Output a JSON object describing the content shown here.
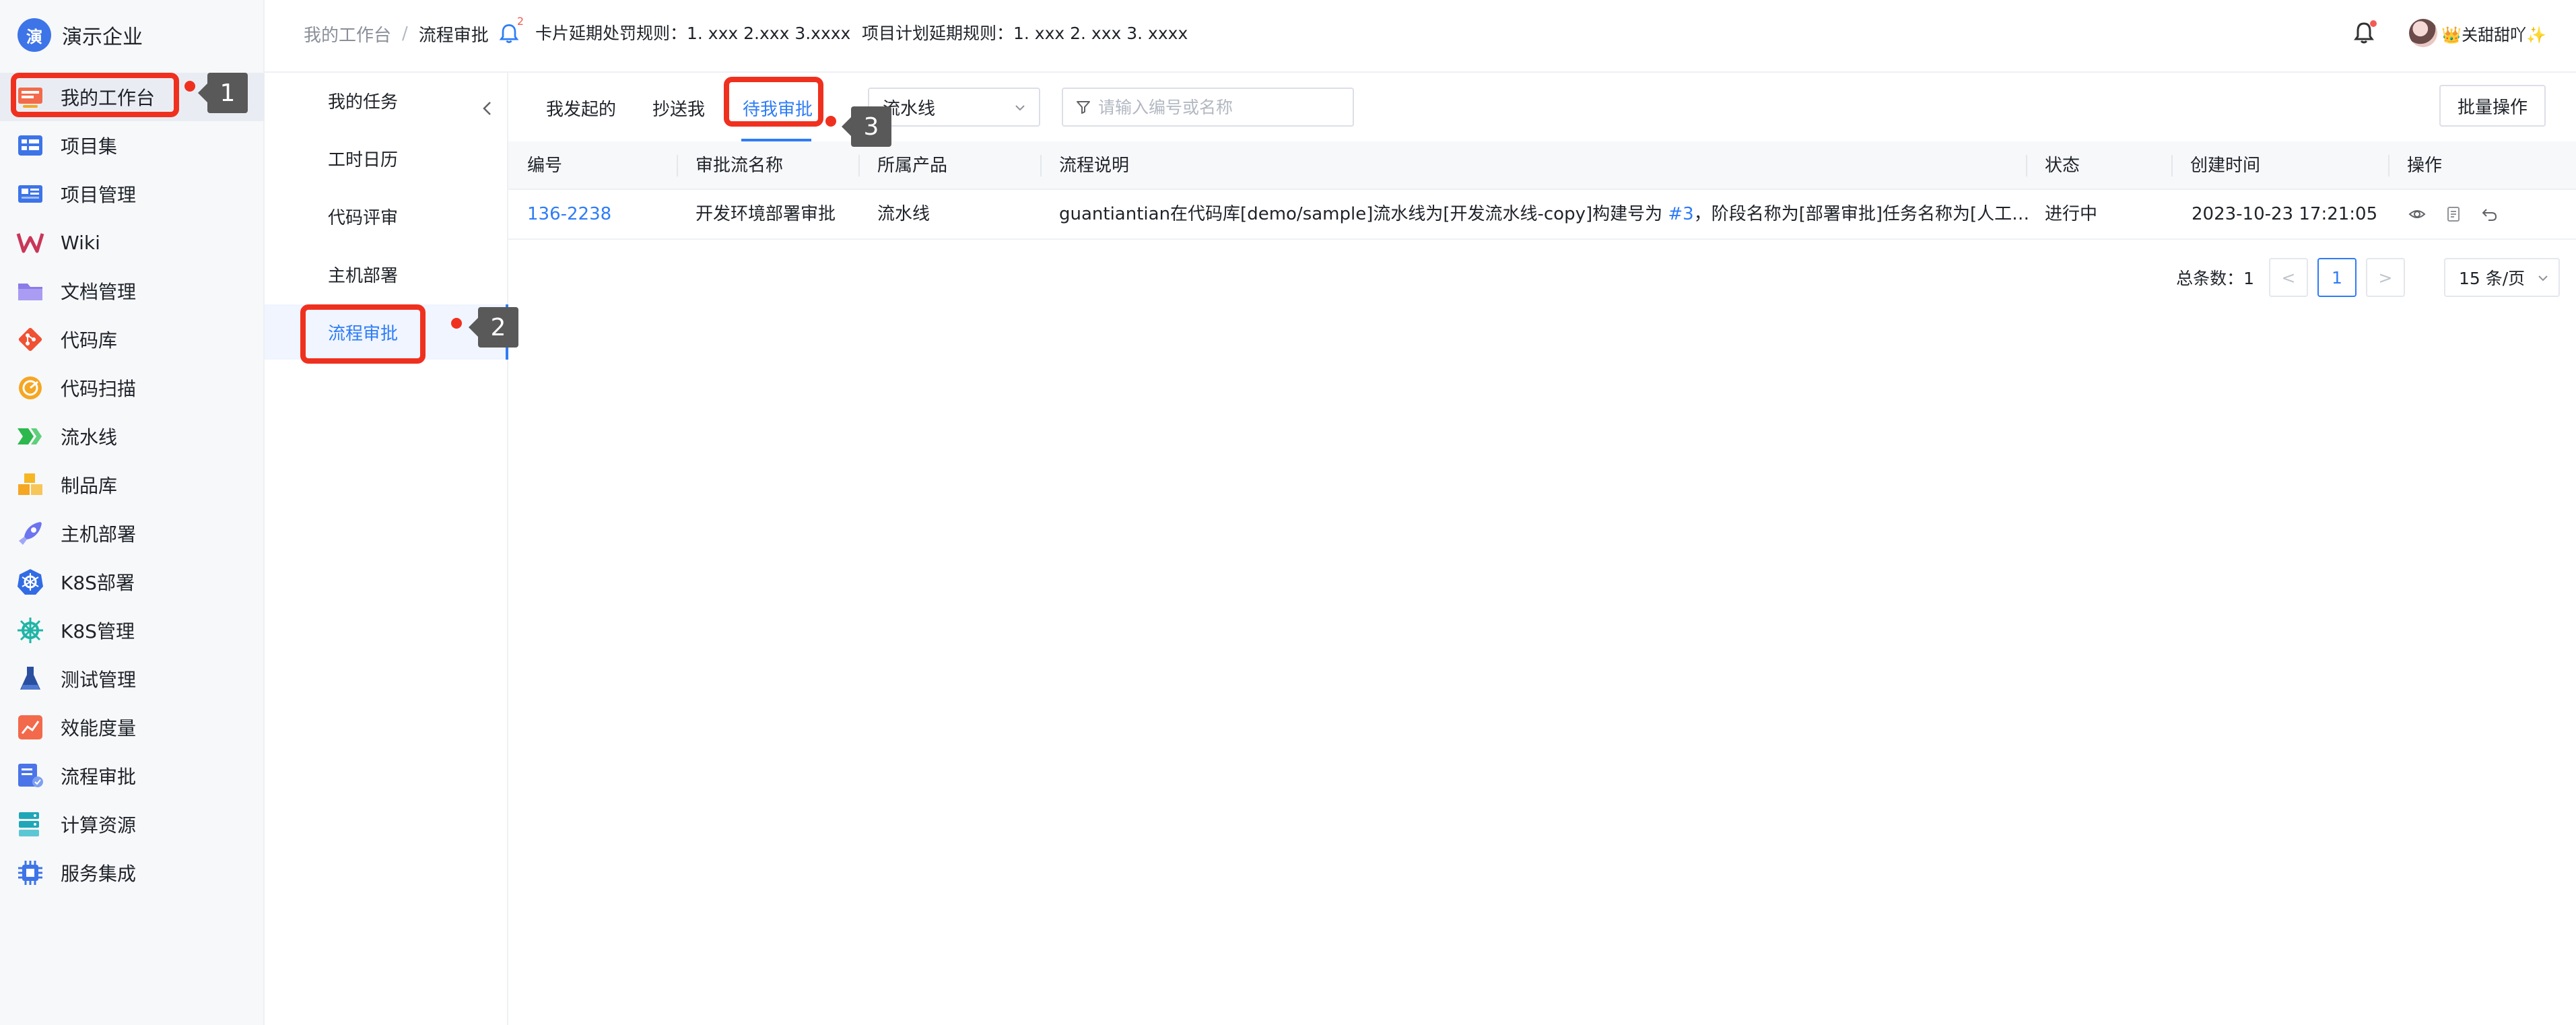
{
  "brand": {
    "logo_char": "演",
    "name": "演示企业"
  },
  "sidebar": {
    "items": [
      {
        "label": "我的工作台",
        "icon": "workbench-icon",
        "color": "#f26a4b"
      },
      {
        "label": "项目集",
        "icon": "project-set-icon",
        "color": "#3d74e8"
      },
      {
        "label": "项目管理",
        "icon": "project-manage-icon",
        "color": "#3d74e8"
      },
      {
        "label": "Wiki",
        "icon": "wiki-icon",
        "color": "#c9365a"
      },
      {
        "label": "文档管理",
        "icon": "folder-icon",
        "color": "#8b7be8"
      },
      {
        "label": "代码库",
        "icon": "git-icon",
        "color": "#f05133"
      },
      {
        "label": "代码扫描",
        "icon": "scan-icon",
        "color": "#f5a623"
      },
      {
        "label": "流水线",
        "icon": "pipeline-icon",
        "color": "#2db84d"
      },
      {
        "label": "制品库",
        "icon": "artifact-icon",
        "color": "#f5b623"
      },
      {
        "label": "主机部署",
        "icon": "rocket-icon",
        "color": "#6c74f0"
      },
      {
        "label": "K8S部署",
        "icon": "kubernetes-icon",
        "color": "#326ce5"
      },
      {
        "label": "K8S管理",
        "icon": "helm-icon",
        "color": "#1fb5a6"
      },
      {
        "label": "测试管理",
        "icon": "flask-icon",
        "color": "#2a4fa0"
      },
      {
        "label": "效能度量",
        "icon": "chart-icon",
        "color": "#f26a4b"
      },
      {
        "label": "流程审批",
        "icon": "flow-icon",
        "color": "#4a74e8"
      },
      {
        "label": "计算资源",
        "icon": "server-icon",
        "color": "#1fa7b8"
      },
      {
        "label": "服务集成",
        "icon": "chip-icon",
        "color": "#3d74e8"
      }
    ]
  },
  "header": {
    "breadcrumb": [
      "我的工作台",
      "流程审批"
    ],
    "breadcrumb_sep": "/",
    "notice_count": "2",
    "rule1": "卡片延期处罚规则：1. xxx 2.xxx 3.xxxx",
    "rule2": "项目计划延期规则：1. xxx 2. xxx 3. xxxx",
    "user_name": "👑关甜甜吖✨"
  },
  "submenu": {
    "items": [
      "我的任务",
      "工时日历",
      "代码评审",
      "主机部署",
      "流程审批"
    ],
    "active_index": 4
  },
  "tabs": [
    "我发起的",
    "抄送我",
    "待我审批"
  ],
  "filter": {
    "selected": "流水线",
    "search_placeholder": "请输入编号或名称",
    "batch_label": "批量操作"
  },
  "table": {
    "columns": [
      "编号",
      "审批流名称",
      "所属产品",
      "流程说明",
      "状态",
      "创建时间",
      "操作"
    ],
    "rows": [
      {
        "id": "136-2238",
        "name": "开发环境部署审批",
        "product": "流水线",
        "desc_prefix": "guantiantian在代码库[demo/sample]流水线为[开发流水线-copy]构建号为 ",
        "desc_link": "#3",
        "desc_suffix": "，阶段名称为[部署审批]任务名称为[人工审批...",
        "status": "进行中",
        "created": "2023-10-23 17:21:05"
      }
    ]
  },
  "pagination": {
    "total_label": "总条数：1",
    "prev": "<",
    "current": "1",
    "next": ">",
    "page_size": "15 条/页"
  },
  "annotations": [
    "1",
    "2",
    "3"
  ],
  "colors": {
    "accent": "#2e7cf6",
    "highlight": "#f0301f",
    "callout": "#595959"
  }
}
